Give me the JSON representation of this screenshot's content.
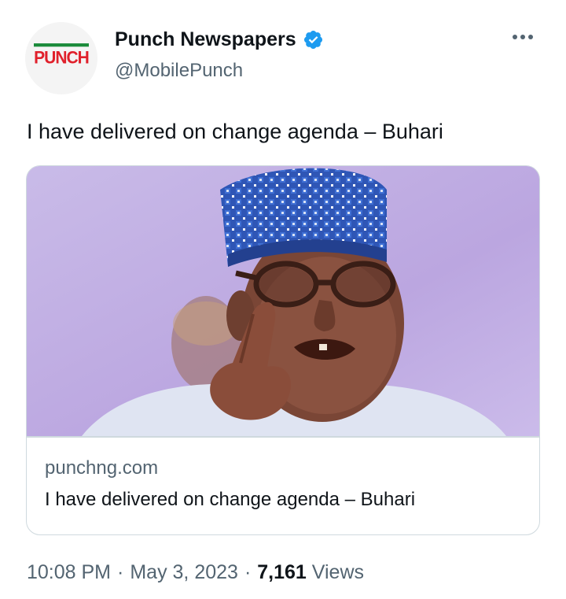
{
  "author": {
    "avatar_logo_text": "PUNCH",
    "display_name": "Punch Newspapers",
    "handle": "@MobilePunch",
    "verified": true,
    "verified_color": "#1d9bf0"
  },
  "tweet": {
    "text": "I have delivered on change agenda – Buhari"
  },
  "card": {
    "domain": "punchng.com",
    "title": "I have delivered on change agenda – Buhari"
  },
  "meta": {
    "time": "10:08 PM",
    "separator": "·",
    "date": "May 3, 2023",
    "view_count": "7,161",
    "views_label": "Views"
  },
  "icons": {
    "more": "more-horizontal-icon",
    "verified": "verified-badge-icon"
  },
  "colors": {
    "logo_red": "#e0202b",
    "logo_green": "#1a8a3a",
    "secondary_text": "#536471",
    "primary_text": "#0f1419",
    "border": "#cfd9de"
  }
}
